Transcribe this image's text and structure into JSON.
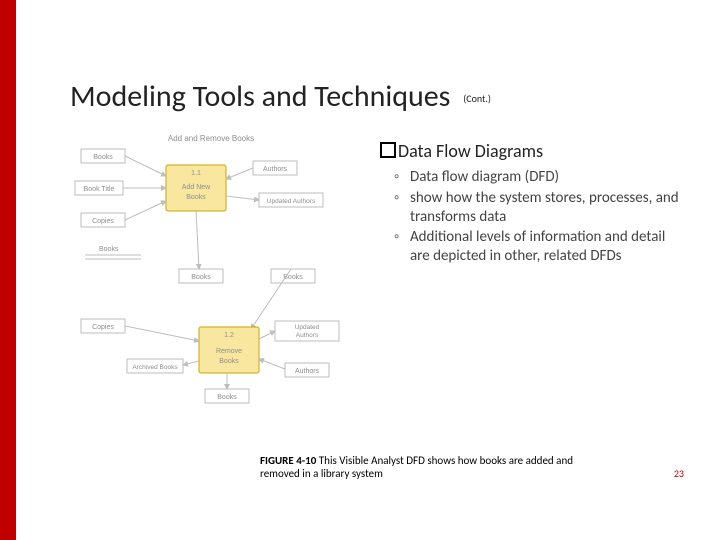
{
  "title": "Modeling Tools and Techniques",
  "title_cont": "(Cont.)",
  "heading": "Data Flow Diagrams",
  "bullets": [
    "Data flow diagram (DFD)",
    "show how the system stores, processes, and transforms data",
    "Additional levels of information and detail are depicted in other, related DFDs"
  ],
  "caption_label": "FIGURE 4-10",
  "caption_text": " This Visible Analyst DFD shows how books are added and removed in a library system",
  "page_number": "23",
  "diagram": {
    "top_title": "Add and Remove Books",
    "nodes": {
      "books1": "Books",
      "booktitle": "Book Title",
      "copies1": "Copies",
      "authors": "Authors",
      "upd_auth1": "Updated Authors",
      "proc1_no": "1.1",
      "proc1_name": "Add New Books",
      "books_mid_l": "Books",
      "books_mid_r": "Books",
      "copies2": "Copies",
      "archived": "Archived Books",
      "upd_auth2": "Updated Authors",
      "authors2": "Authors",
      "proc2_no": "1.2",
      "proc2_name": "Remove Books",
      "books_bot": "Books"
    }
  }
}
